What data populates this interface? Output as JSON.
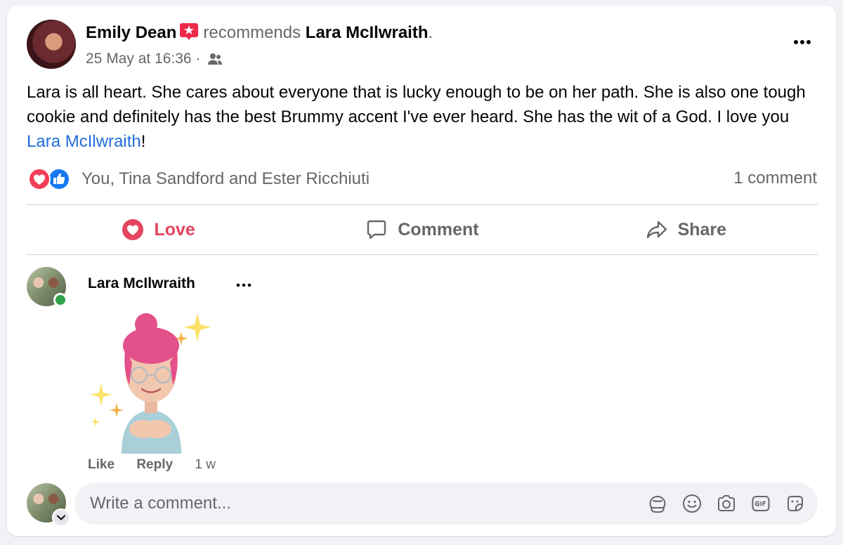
{
  "post": {
    "author": "Emily Dean",
    "verb": "recommends",
    "target": "Lara McIlwraith",
    "period": ".",
    "timestamp": "25 May at 16:36",
    "separator": "·",
    "audience_icon": "friends-icon",
    "text_main": "Lara is all heart. She cares about everyone that is lucky enough to be on her path. She is also one tough cookie and definitely has the best Brummy accent I've ever heard. She has the wit of a God. I love you ",
    "mention": "Lara McIlwraith",
    "text_end": "!"
  },
  "reactions": {
    "icons": [
      "love-reaction-icon",
      "like-reaction-icon"
    ],
    "summary": "You, Tina Sandford and Ester Ricchiuti",
    "comment_count": "1 comment"
  },
  "actions": {
    "love": "Love",
    "comment": "Comment",
    "share": "Share"
  },
  "comment": {
    "author": "Lara McIlwraith",
    "like": "Like",
    "reply": "Reply",
    "time": "1 w"
  },
  "composer": {
    "placeholder": "Write a comment...",
    "tools": [
      "avatar-sticker-icon",
      "emoji-icon",
      "camera-icon",
      "gif-icon",
      "sticker-icon"
    ]
  },
  "colors": {
    "love": "#e3455e",
    "link": "#216fdb",
    "muted": "#65676b",
    "online": "#31a24c"
  }
}
